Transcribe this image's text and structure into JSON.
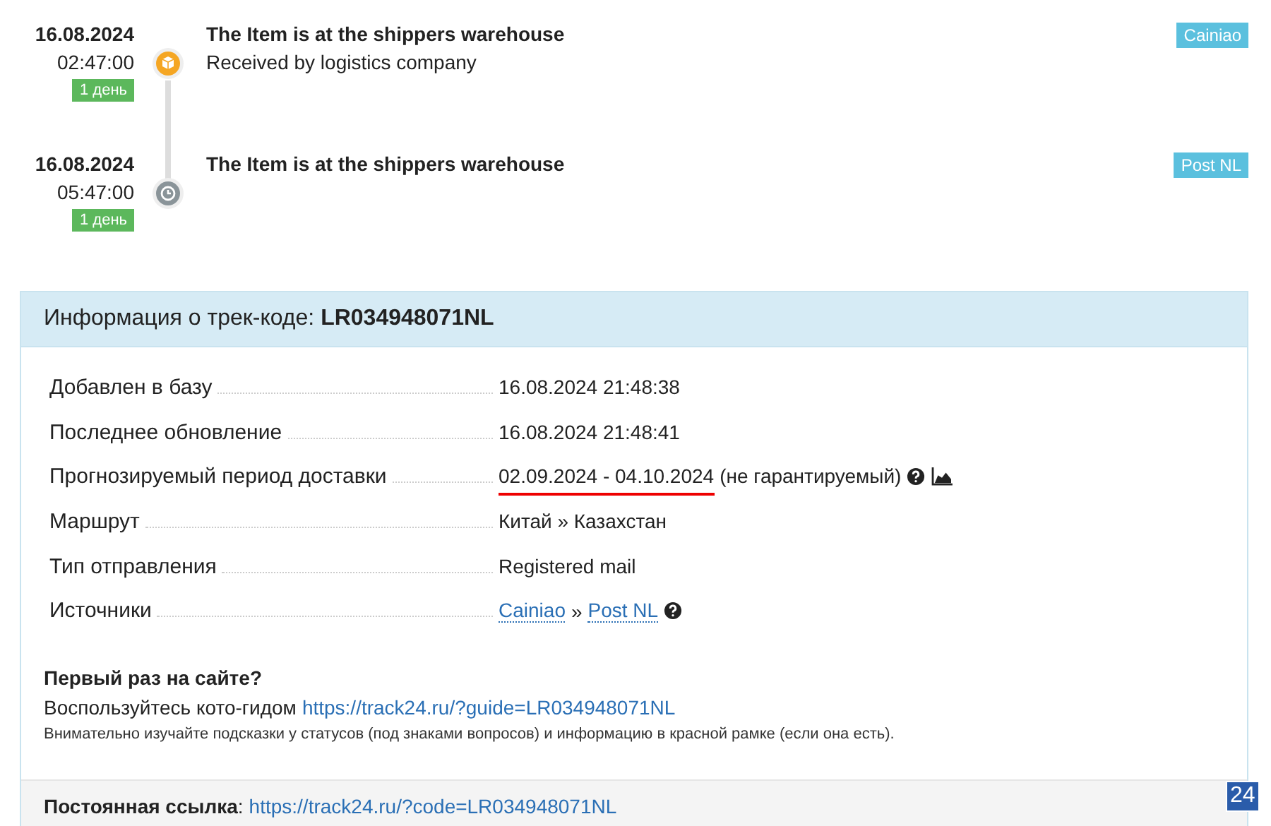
{
  "events": [
    {
      "date": "16.08.2024",
      "time": "02:47:00",
      "duration": "1 день",
      "kind": "received",
      "title": "The Item is at the shippers warehouse",
      "description": "Received by logistics company",
      "source": "Cainiao"
    },
    {
      "date": "16.08.2024",
      "time": "05:47:00",
      "duration": "1 день",
      "kind": "pending",
      "title": "The Item is at the shippers warehouse",
      "source": "Post NL"
    }
  ],
  "info": {
    "title": "Информация о трек-коде:",
    "code": "LR034948071NL",
    "rows": [
      {
        "kind": "plain",
        "label": "Добавлен в базу",
        "value": "16.08.2024 21:48:38"
      },
      {
        "kind": "plain",
        "label": "Последнее обновление",
        "value": "16.08.2024 21:48:41"
      },
      {
        "kind": "forecast",
        "label": "Прогнозируемый период доставки",
        "value": "02.09.2024 - 04.10.2024",
        "note": "(не гарантируемый)"
      },
      {
        "kind": "plain",
        "label": "Маршрут",
        "value": "Китай » Казахстан"
      },
      {
        "kind": "plain",
        "label": "Тип отправления",
        "value": "Registered mail"
      },
      {
        "kind": "sources",
        "label": "Источники",
        "links": [
          "Cainiao",
          "Post NL"
        ],
        "separator": "»"
      }
    ],
    "first_visit": {
      "heading": "Первый раз на сайте?",
      "text": "Воспользуйтесь кото-гидом",
      "link": "https://track24.ru/?guide=LR034948071NL",
      "note": "Внимательно изучайте подсказки у статусов (под знаками вопросов) и информацию в красной рамке (если она есть)."
    },
    "permalink": {
      "label": "Постоянная ссылка",
      "colon": ":",
      "link": "https://track24.ru/?code=LR034948071NL"
    }
  },
  "badge": "24"
}
